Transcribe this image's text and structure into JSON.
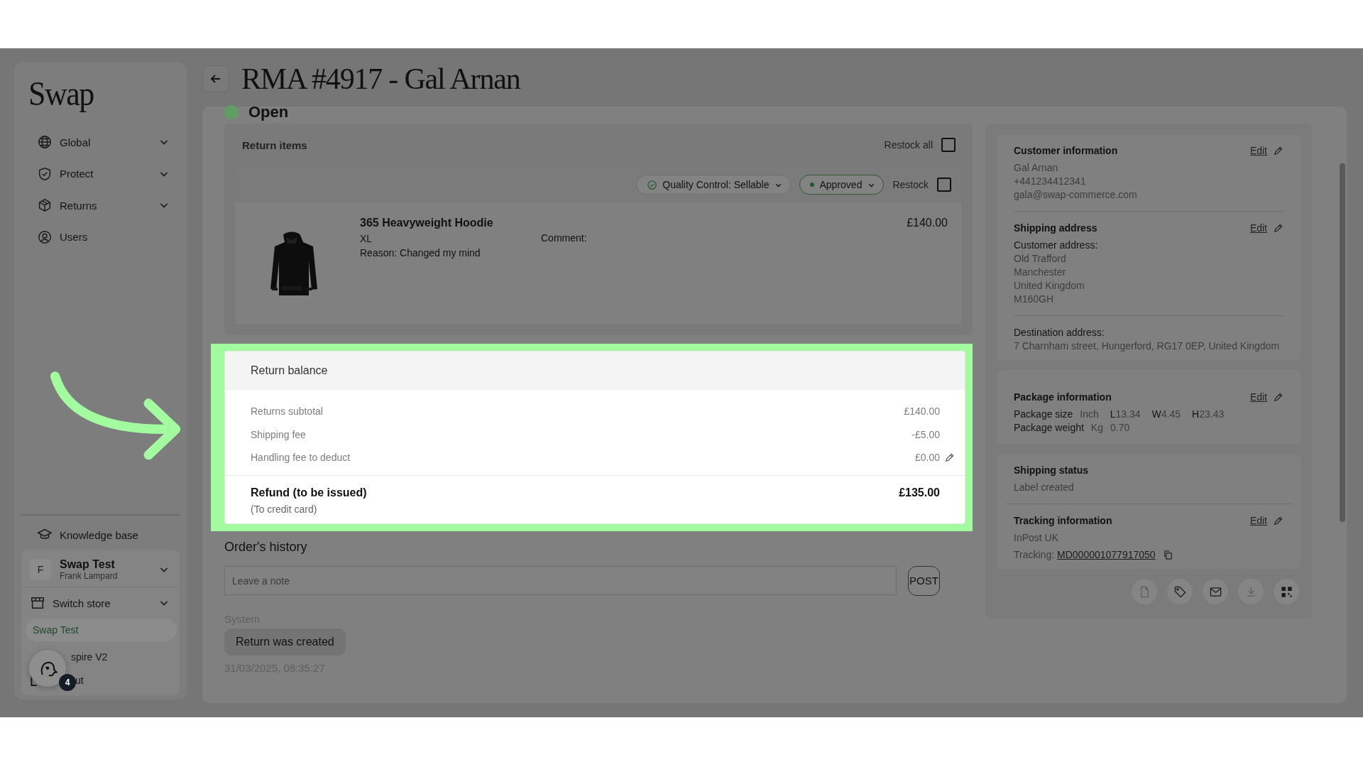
{
  "page": {
    "title": "RMA #4917 - Gal Arnan",
    "status": "Open"
  },
  "sidebar": {
    "logo": "Swap",
    "nav": [
      {
        "label": "Global",
        "has_submenu": true
      },
      {
        "label": "Protect",
        "has_submenu": true
      },
      {
        "label": "Returns",
        "has_submenu": true
      },
      {
        "label": "Users",
        "has_submenu": false
      }
    ],
    "knowledge_base": "Knowledge base",
    "account": {
      "initial": "F",
      "name": "Swap Test",
      "user": "Frank Lampard"
    },
    "switch_store": "Switch store",
    "stores": [
      {
        "label": "Swap Test",
        "selected": true
      },
      {
        "label": "spire V2",
        "selected": false
      }
    ],
    "logout": "ut",
    "help_badge": "4"
  },
  "return_items": {
    "title": "Return items",
    "restock_all": {
      "label": "Restock all",
      "checked": false
    },
    "items": [
      {
        "quality": "Quality Control: Sellable",
        "status": "Approved",
        "restock": {
          "label": "Restock",
          "checked": false
        },
        "name": "365 Heavyweight Hoodie",
        "size": "XL",
        "reason": "Reason: Changed my mind",
        "comment": "Comment:",
        "price": "£140.00"
      }
    ]
  },
  "return_balance": {
    "title": "Return balance",
    "highlighted": true,
    "lines": [
      {
        "label": "Returns subtotal",
        "amount": "£140.00",
        "editable": false
      },
      {
        "label": "Shipping fee",
        "amount": "-£5.00",
        "editable": false
      },
      {
        "label": "Handling fee to deduct",
        "amount": "£0.00",
        "editable": true
      }
    ],
    "total": {
      "label": "Refund (to be issued)",
      "note": "(To credit card)",
      "amount": "£135.00"
    }
  },
  "history": {
    "title": "Order's history",
    "note_placeholder": "Leave a note",
    "post": "POST",
    "entries": [
      {
        "author": "System",
        "message": "Return was created",
        "time": "31/03/2025, 08:35:27"
      }
    ]
  },
  "customer": {
    "title": "Customer information",
    "edit": "Edit",
    "lines": [
      "Gal Arnan",
      "+441234412341",
      "gala@swap-commerce.com"
    ]
  },
  "shipping_address": {
    "title": "Shipping address",
    "edit": "Edit",
    "customer_label": "Customer address:",
    "customer_lines": [
      "Old Trafford",
      "Manchester",
      "United Kingdom",
      "M160GH"
    ],
    "destination_label": "Destination address:",
    "destination": "7 Charnham street, Hungerford, RG17 0EP, United Kingdom"
  },
  "package": {
    "title": "Package information",
    "edit": "Edit",
    "size_label": "Package size",
    "size_unit": "Inch",
    "dims": [
      {
        "axis": "L",
        "value": "13.34"
      },
      {
        "axis": "W",
        "value": "4.45"
      },
      {
        "axis": "H",
        "value": "23.43"
      }
    ],
    "weight_label": "Package weight",
    "weight_unit": "Kg",
    "weight": "0.70"
  },
  "shipping_status": {
    "title": "Shipping status",
    "value": "Label created"
  },
  "tracking": {
    "title": "Tracking information",
    "edit": "Edit",
    "carrier": "InPost UK",
    "tracking_label": "Tracking:",
    "tracking_number": "MD000001077917050"
  }
}
